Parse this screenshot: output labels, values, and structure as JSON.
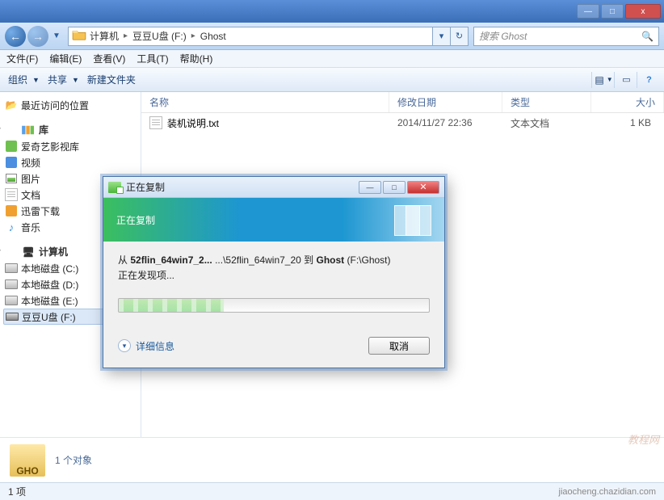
{
  "window": {
    "minimize": "—",
    "maximize": "□",
    "close": "x"
  },
  "nav": {
    "back": "←",
    "forward": "→",
    "history_dropdown": "▼"
  },
  "breadcrumb": {
    "items": [
      "计算机",
      "豆豆U盘 (F:)",
      "Ghost"
    ],
    "sep": "▸"
  },
  "addressbar": {
    "dropdown": "▾",
    "refresh": "↻"
  },
  "search": {
    "placeholder": "搜索 Ghost",
    "icon": "🔍"
  },
  "menu": {
    "items": [
      "文件(F)",
      "编辑(E)",
      "查看(V)",
      "工具(T)",
      "帮助(H)"
    ]
  },
  "toolbar": {
    "organize": "组织",
    "share": "共享",
    "newfolder": "新建文件夹",
    "dropdown": "▼",
    "view_icon": "▤",
    "help_icon": "?"
  },
  "sidebar": {
    "recent": "最近访问的位置",
    "libraries_label": "库",
    "libraries": [
      {
        "label": "爱奇艺影视库",
        "iconclass": "lib-box lib-green"
      },
      {
        "label": "视频",
        "iconclass": "lib-box lib-blue"
      },
      {
        "label": "图片",
        "iconclass": "image-icon"
      },
      {
        "label": "文档",
        "iconclass": "txt-icon"
      },
      {
        "label": "迅雷下载",
        "iconclass": "lib-box lib-orange"
      },
      {
        "label": "音乐",
        "iconclass": "music-note",
        "textIcon": "♪"
      }
    ],
    "computer_label": "计算机",
    "drives": [
      {
        "label": "本地磁盘 (C:)",
        "iconclass": "disk-icon"
      },
      {
        "label": "本地磁盘 (D:)",
        "iconclass": "disk-icon"
      },
      {
        "label": "本地磁盘 (E:)",
        "iconclass": "disk-icon"
      },
      {
        "label": "豆豆U盘 (F:)",
        "iconclass": "usb-icon",
        "active": true
      }
    ]
  },
  "columns": {
    "name": "名称",
    "date": "修改日期",
    "type": "类型",
    "size": "大小"
  },
  "files": [
    {
      "name": "装机说明.txt",
      "date": "2014/11/27 22:36",
      "type": "文本文档",
      "size": "1 KB"
    }
  ],
  "details": {
    "gho_label": "GHO",
    "count_text": "1 个对象"
  },
  "status": {
    "left": "1 项",
    "right": "jiaocheng.chazidian.com"
  },
  "dialog": {
    "title": "正在复制",
    "banner": "正在复制",
    "from_prefix": "从 ",
    "from_bold": "52flin_64win7_2...",
    "from_mid": " ...\\52flin_64win7_20 到 ",
    "from_dest_bold": "Ghost",
    "from_suffix": " (F:\\Ghost)",
    "discovering": "正在发现项...",
    "moreinfo": "详细信息",
    "cancel": "取消",
    "min": "—",
    "max": "□",
    "close": "✕"
  },
  "watermark": "教程网"
}
